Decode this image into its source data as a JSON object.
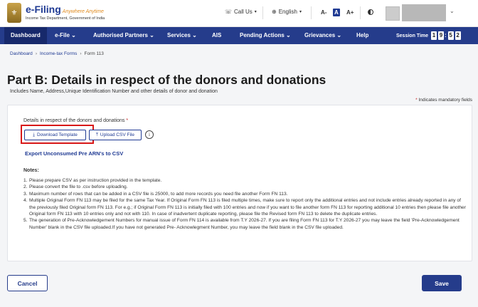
{
  "header": {
    "logo_main": "e-Filing",
    "logo_tag": "Anywhere Anytime",
    "logo_sub": "Income Tax Department, Government of India",
    "call_us": "Call Us",
    "language": "English",
    "font_small": "A-",
    "font_normal": "A",
    "font_large": "A+"
  },
  "nav": {
    "items": [
      "Dashboard",
      "e-File",
      "Authorised Partners",
      "Services",
      "AIS",
      "Pending Actions",
      "Grievances",
      "Help"
    ],
    "session_label": "Session Time",
    "session_digits": [
      "1",
      "9",
      "5",
      "2"
    ]
  },
  "breadcrumb": [
    "Dashboard",
    "Income-tax Forms",
    "Form 113"
  ],
  "page": {
    "title": "Part B: Details in respect of the donors and donations",
    "subtitle": "Includes Name, Address,Unique Identification Number and other details of donor and donation",
    "mandatory_note": "Indicates mandatory fields"
  },
  "form": {
    "field_label": "Details in respect of the donors and donations",
    "download_label": "Download Template",
    "upload_label": "Upload CSV File",
    "export_link": "Export Unconsumed Pre ARN's to CSV",
    "notes_title": "Notes:",
    "notes": [
      "Please prepare CSV as per instruction provided in the template.",
      "Please convert the file to .csv before uploading.",
      "Maximum number of rows that can be added in a CSV file is 25000, to add more records you need file another Form FN 113.",
      "Multiple Original Form FN 113 may be filed for the same Tax Year. If Original Form FN 113 is filed multiple times, make sure to report only the additional entries and not include entries already reported in any of the previously filed Original form FN 113. For e.g.; if Original Form FN 113 is initially filed with 100 entries and now if you want to file another form FN 113 for reporting additional 10 entries then please file another Original form FN 113 with 10 entries only and not with 110. In case of inadvertent duplicate reporting, please file the Revised form FN 113 to delete the duplicate entries.",
      "The generation of Pre-Acknowledgement Numbers for manual issue of Form FN 114 is available from T.Y 2026-27. If you are filing Form FN 113 for T.Y 2026-27 you may leave the field 'Pre-Acknowledgement Number' blank in the CSV file uploaded.If you have not generated Pre- Acknowlegment Number, you may leave the field blank in the CSV file uploaded."
    ]
  },
  "footer": {
    "cancel_label": "Cancel",
    "save_label": "Save"
  }
}
